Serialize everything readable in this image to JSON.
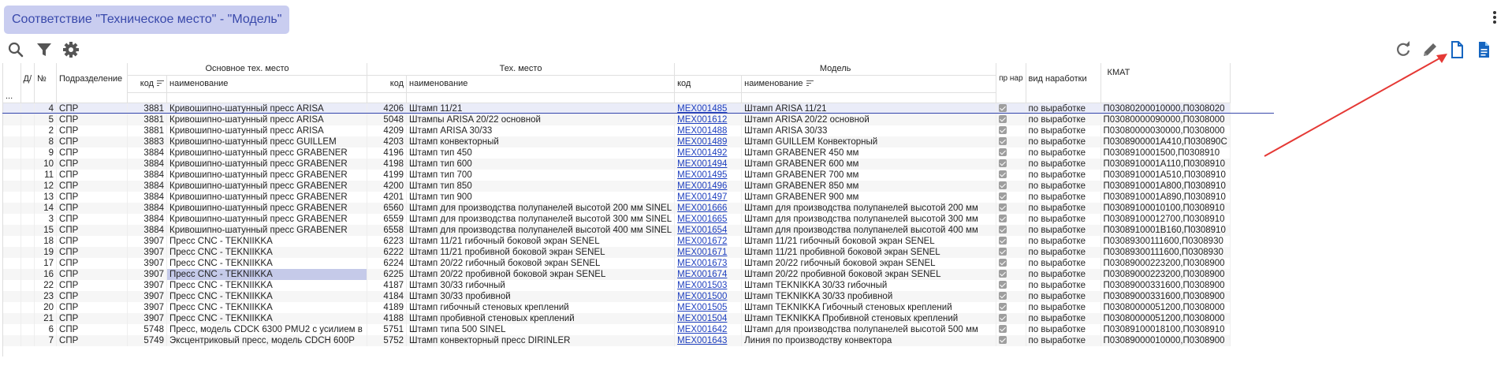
{
  "title": "Соответствие \"Техническое место\" - \"Модель\"",
  "toolbar": {
    "left_icons": [
      "search-icon",
      "filter-icon",
      "gear-icon"
    ],
    "right_icons": [
      "refresh-icon",
      "edit-icon",
      "document-outline-icon",
      "document-filled-icon"
    ]
  },
  "columns": {
    "menu": "...",
    "d": "Д/",
    "num": "№",
    "dept": "Подразделение",
    "group_main": "Основное тех. место",
    "group_tech": "Тех. место",
    "group_model": "Модель",
    "main_code": "код",
    "main_name": "наименование",
    "tech_code": "код",
    "tech_name": "наименование",
    "model_code": "код",
    "model_name": "наименование",
    "pr": "пр нар",
    "vid": "вид наработки",
    "kmat": "КМАТ"
  },
  "rows": [
    {
      "n": "4",
      "dept": "СПР",
      "mcode": "3881",
      "mname": "Кривошипно-шатунный пресс ARISA",
      "tcode": "4206",
      "tname": "Штамп 11/21",
      "modcode": "МЕХ001485",
      "modname": "Штамп ARISA 11/21",
      "vid": "по выработке",
      "kmat": "П03080200010000,П0308020"
    },
    {
      "n": "5",
      "dept": "СПР",
      "mcode": "3881",
      "mname": "Кривошипно-шатунный пресс ARISA",
      "tcode": "5048",
      "tname": "Штампы ARISA 20/22 основной",
      "modcode": "МЕХ001612",
      "modname": "Штамп ARISA 20/22 основной",
      "vid": "по выработке",
      "kmat": "П03080000090000,П0308000"
    },
    {
      "n": "2",
      "dept": "СПР",
      "mcode": "3881",
      "mname": "Кривошипно-шатунный пресс ARISA",
      "tcode": "4209",
      "tname": "Штамп ARISA 30/33",
      "modcode": "МЕХ001488",
      "modname": "Штамп ARISA 30/33",
      "vid": "по выработке",
      "kmat": "П03080000030000,П0308000"
    },
    {
      "n": "8",
      "dept": "СПР",
      "mcode": "3883",
      "mname": "Кривошипно-шатунный пресс GUILLEM",
      "tcode": "4203",
      "tname": "Штамп конвекторный",
      "modcode": "МЕХ001489",
      "modname": "Штамп GUILLEM Конвекторный",
      "vid": "по выработке",
      "kmat": "П0308900001A410,П030890С"
    },
    {
      "n": "9",
      "dept": "СПР",
      "mcode": "3884",
      "mname": "Кривошипно-шатунный пресс GRABENER",
      "tcode": "4196",
      "tname": "Штамп тип 450",
      "modcode": "МЕХ001492",
      "modname": "Штамп GRABENER 450 мм",
      "vid": "по выработке",
      "kmat": "П0308910001500,П0308910"
    },
    {
      "n": "10",
      "dept": "СПР",
      "mcode": "3884",
      "mname": "Кривошипно-шатунный пресс GRABENER",
      "tcode": "4198",
      "tname": "Штамп тип 600",
      "modcode": "МЕХ001494",
      "modname": "Штамп GRABENER 600 мм",
      "vid": "по выработке",
      "kmat": "П0308910001A110,П0308910"
    },
    {
      "n": "11",
      "dept": "СПР",
      "mcode": "3884",
      "mname": "Кривошипно-шатунный пресс GRABENER",
      "tcode": "4199",
      "tname": "Штамп тип 700",
      "modcode": "МЕХ001495",
      "modname": "Штамп GRABENER 700 мм",
      "vid": "по выработке",
      "kmat": "П0308910001A510,П0308910"
    },
    {
      "n": "12",
      "dept": "СПР",
      "mcode": "3884",
      "mname": "Кривошипно-шатунный пресс GRABENER",
      "tcode": "4200",
      "tname": "Штамп тип 850",
      "modcode": "МЕХ001496",
      "modname": "Штамп GRABENER 850 мм",
      "vid": "по выработке",
      "kmat": "П0308910001A800,П0308910"
    },
    {
      "n": "13",
      "dept": "СПР",
      "mcode": "3884",
      "mname": "Кривошипно-шатунный пресс GRABENER",
      "tcode": "4201",
      "tname": "Штамп тип 900",
      "modcode": "МЕХ001497",
      "modname": "Штамп GRABENER 900 мм",
      "vid": "по выработке",
      "kmat": "П0308910001A890,П0308910"
    },
    {
      "n": "14",
      "dept": "СПР",
      "mcode": "3884",
      "mname": "Кривошипно-шатунный пресс GRABENER",
      "tcode": "6560",
      "tname": "Штамп для производства полупанелей высотой 200 мм SINEL",
      "modcode": "МЕХ001666",
      "modname": "Штамп для производства полупанелей высотой 200 мм",
      "vid": "по выработке",
      "kmat": "П03089100010100,П0308910"
    },
    {
      "n": "3",
      "dept": "СПР",
      "mcode": "3884",
      "mname": "Кривошипно-шатунный пресс GRABENER",
      "tcode": "6559",
      "tname": "Штамп для производства полупанелей высотой 300 мм SINEL",
      "modcode": "МЕХ001665",
      "modname": "Штамп для производства полупанелей высотой 300 мм",
      "vid": "по выработке",
      "kmat": "П03089100012700,П0308910"
    },
    {
      "n": "15",
      "dept": "СПР",
      "mcode": "3884",
      "mname": "Кривошипно-шатунный пресс GRABENER",
      "tcode": "6558",
      "tname": "Штамп для производства полупанелей высотой 400 мм SINEL",
      "modcode": "МЕХ001654",
      "modname": "Штамп для производства полупанелей высотой 400 мм",
      "vid": "по выработке",
      "kmat": "П0308910001B160,П0308910"
    },
    {
      "n": "18",
      "dept": "СПР",
      "mcode": "3907",
      "mname": "Пресс CNC - TEKNIIKKA",
      "tcode": "6223",
      "tname": "Штамп 11/21 гибочный боковой экран SENEL",
      "modcode": "МЕХ001672",
      "modname": "Штамп 11/21 гибочный боковой экран SENEL",
      "vid": "по выработке",
      "kmat": "П03089300111600,П0308930"
    },
    {
      "n": "19",
      "dept": "СПР",
      "mcode": "3907",
      "mname": "Пресс CNC - TEKNIIKKA",
      "tcode": "6222",
      "tname": "Штамп 11/21 пробивной боковой экран SENEL",
      "modcode": "МЕХ001671",
      "modname": "Штамп 11/21 пробивной боковой экран SENEL",
      "vid": "по выработке",
      "kmat": "П03089300111600,П0308930"
    },
    {
      "n": "17",
      "dept": "СПР",
      "mcode": "3907",
      "mname": "Пресс CNC - TEKNIIKKA",
      "tcode": "6224",
      "tname": "Штамп 20/22 гибочный боковой экран SENEL",
      "modcode": "МЕХ001673",
      "modname": "Штамп 20/22 гибочный боковой экран SENEL",
      "vid": "по выработке",
      "kmat": "П03089000223200,П0308900"
    },
    {
      "n": "16",
      "dept": "СПР",
      "mcode": "3907",
      "mname": "Пресс CNC - TEKNIIKKA",
      "tcode": "6225",
      "tname": "Штамп 20/22 пробивной боковой экран SENEL",
      "modcode": "МЕХ001674",
      "modname": "Штамп 20/22 пробивной боковой экран SENEL",
      "vid": "по выработке",
      "kmat": "П03089000223200,П0308900"
    },
    {
      "n": "22",
      "dept": "СПР",
      "mcode": "3907",
      "mname": "Пресс CNC - TEKNIIKKA",
      "tcode": "4187",
      "tname": "Штамп 30/33 гибочный",
      "modcode": "МЕХ001503",
      "modname": "Штамп TEKNIKKA 30/33 гибочный",
      "vid": "по выработке",
      "kmat": "П03089000331600,П0308900"
    },
    {
      "n": "23",
      "dept": "СПР",
      "mcode": "3907",
      "mname": "Пресс CNC - TEKNIIKKA",
      "tcode": "4184",
      "tname": "Штамп 30/33 пробивной",
      "modcode": "МЕХ001500",
      "modname": "Штамп TEKNIKKA 30/33 пробивной",
      "vid": "по выработке",
      "kmat": "П03089000331600,П0308900"
    },
    {
      "n": "20",
      "dept": "СПР",
      "mcode": "3907",
      "mname": "Пресс CNC - TEKNIIKKA",
      "tcode": "4189",
      "tname": "Штамп гибочный стеновых креплений",
      "modcode": "МЕХ001505",
      "modname": "Штамп TEKNIKKA Гибочный стеновых креплений",
      "vid": "по выработке",
      "kmat": "П03080000051200,П0308000"
    },
    {
      "n": "21",
      "dept": "СПР",
      "mcode": "3907",
      "mname": "Пресс CNC - TEKNIIKKA",
      "tcode": "4188",
      "tname": "Штамп пробивной стеновых креплений",
      "modcode": "МЕХ001504",
      "modname": "Штамп TEKNIKKA Пробивной стеновых креплений",
      "vid": "по выработке",
      "kmat": "П03080000051200,П0308000"
    },
    {
      "n": "6",
      "dept": "СПР",
      "mcode": "5748",
      "mname": "Пресс, модель CDCK 6300 PMU2 с усилием в",
      "tcode": "5751",
      "tname": "Штамп типа 500 SINEL",
      "modcode": "МЕХ001642",
      "modname": "Штамп для производства полупанелей высотой 500 мм",
      "vid": "по выработке",
      "kmat": "П03089100018100,П0308910"
    },
    {
      "n": "7",
      "dept": "СПР",
      "mcode": "5749",
      "mname": "Эксцентриковый пресс, модель CDCH 600P",
      "tcode": "5752",
      "tname": "Штамп конвекторный пресс DIRINLER",
      "modcode": "МЕХ001643",
      "modname": "Линия по производству конвектора",
      "vid": "по выработке",
      "kmat": "П03089000010000,П0308900"
    }
  ]
}
